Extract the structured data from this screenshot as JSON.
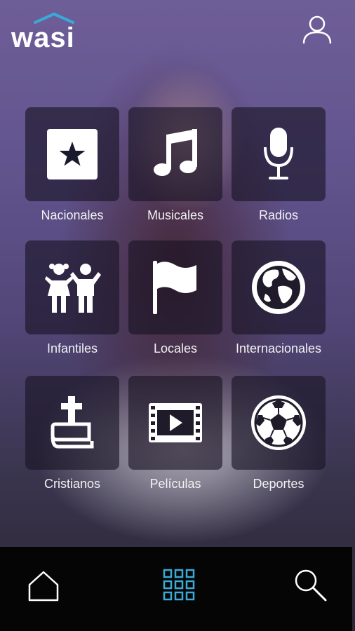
{
  "app": {
    "brand": "wasi",
    "accent": "#3aa9d6"
  },
  "header": {
    "profile_icon": "user-icon"
  },
  "categories": [
    {
      "label": "Nacionales",
      "icon": "star-icon"
    },
    {
      "label": "Musicales",
      "icon": "music-note-icon"
    },
    {
      "label": "Radios",
      "icon": "microphone-icon"
    },
    {
      "label": "Infantiles",
      "icon": "children-icon"
    },
    {
      "label": "Locales",
      "icon": "flag-icon"
    },
    {
      "label": "Internacionales",
      "icon": "globe-icon"
    },
    {
      "label": "Cristianos",
      "icon": "bible-cross-icon"
    },
    {
      "label": "Películas",
      "icon": "film-icon"
    },
    {
      "label": "Deportes",
      "icon": "soccer-ball-icon"
    }
  ],
  "bottom_nav": {
    "items": [
      {
        "name": "home",
        "icon": "home-icon",
        "active": false
      },
      {
        "name": "grid",
        "icon": "grid-icon",
        "active": true
      },
      {
        "name": "search",
        "icon": "search-icon",
        "active": false
      }
    ]
  }
}
